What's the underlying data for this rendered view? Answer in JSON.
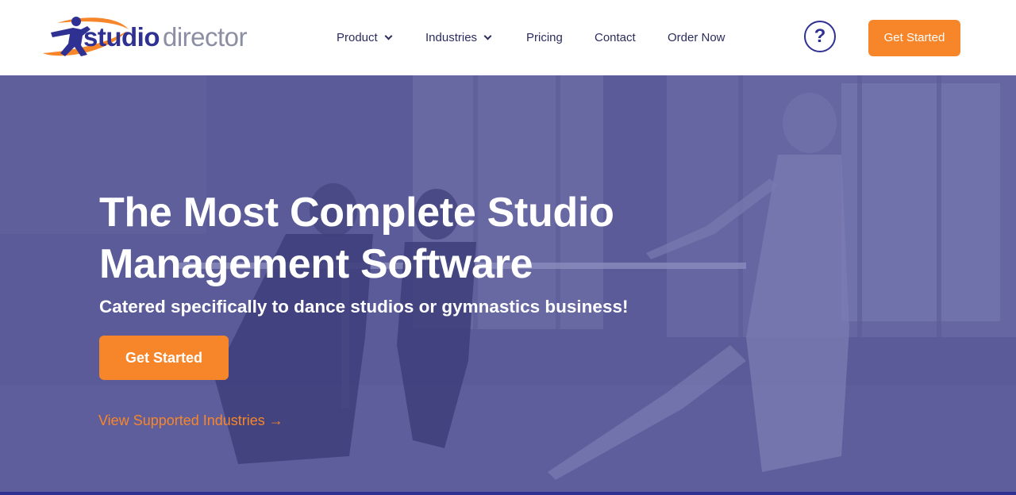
{
  "header": {
    "logo": {
      "word1": "studio",
      "word2": "director"
    },
    "nav": [
      {
        "label": "Product",
        "dropdown": true
      },
      {
        "label": "Industries",
        "dropdown": true
      },
      {
        "label": "Pricing",
        "dropdown": false
      },
      {
        "label": "Contact",
        "dropdown": false
      },
      {
        "label": "Order Now",
        "dropdown": false
      }
    ],
    "help_label": "?",
    "cta_label": "Get Started"
  },
  "hero": {
    "title": "The Most Complete Studio Management Software",
    "subtitle": "Catered specifically to dance studios or gymnastics business!",
    "cta_label": "Get Started",
    "link_label": "View Supported Industries →"
  },
  "colors": {
    "brand_blue": "#2e3192",
    "accent_orange": "#f7862a",
    "hero_overlay": "#5a5b98",
    "nav_text": "#2b2d5e"
  },
  "icons": [
    "logo-figure-icon",
    "chevron-down-icon",
    "help-icon"
  ]
}
